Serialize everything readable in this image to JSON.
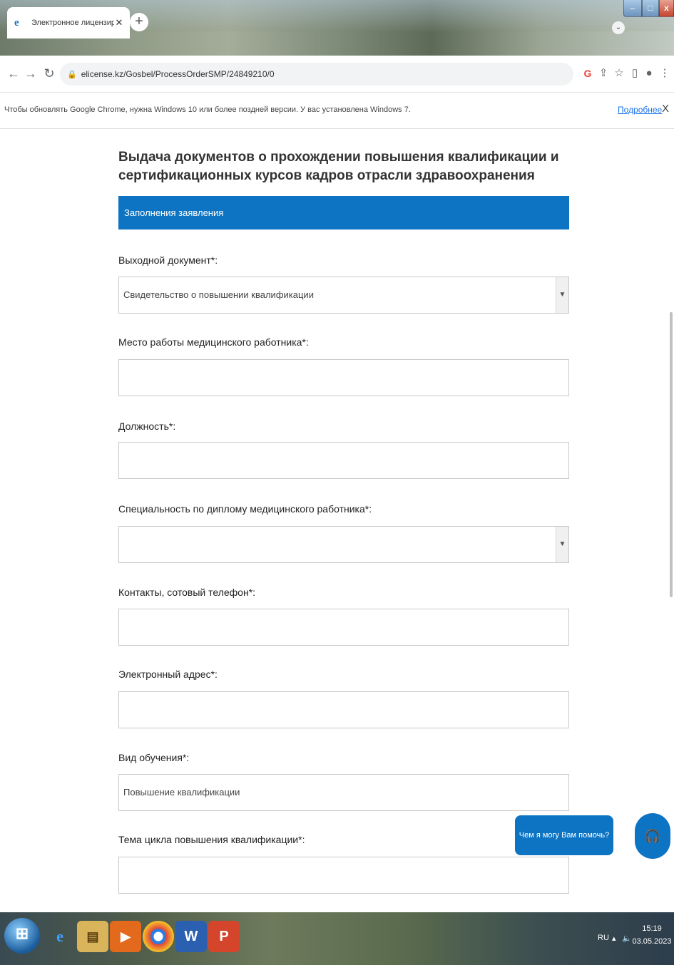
{
  "browser": {
    "tab_title": "Электронное лицензирование",
    "tab_close": "✕",
    "new_tab": "+",
    "url": "elicense.kz/Gosbel/ProcessOrderSMP/24849210/0"
  },
  "infobar": {
    "message": "Чтобы обновлять Google Chrome, нужна Windows 10 или более поздней версии. У вас установлена Windows 7.",
    "more_link": "Подробнее",
    "close": "X"
  },
  "page": {
    "title": "Выдача документов о прохождении повышения квалификации и сертификационных курсов кадров отрасли здравоохранения",
    "section": "Заполнения заявления"
  },
  "form": {
    "output_doc": {
      "label": "Выходной документ*:",
      "value": "Свидетельство о повышении квалификации"
    },
    "workplace": {
      "label": "Место работы медицинского работника*:",
      "value": ""
    },
    "position": {
      "label": "Должность*:",
      "value": ""
    },
    "specialty": {
      "label": "Специальность по диплому медицинского работника*:",
      "value": ""
    },
    "phone": {
      "label": "Контакты, сотовый телефон*:",
      "value": ""
    },
    "email": {
      "label": "Электронный адрес*:",
      "value": ""
    },
    "training_type": {
      "label": "Вид обучения*:",
      "value": "Повышение квалификации"
    },
    "cycle_topic": {
      "label": "Тема цикла повышения квалификации*:",
      "value": ""
    }
  },
  "help": {
    "bubble_text": "Чем я могу Вам помочь?"
  },
  "taskbar": {
    "lang": "RU",
    "time": "15:19",
    "date": "03.05.2023"
  }
}
